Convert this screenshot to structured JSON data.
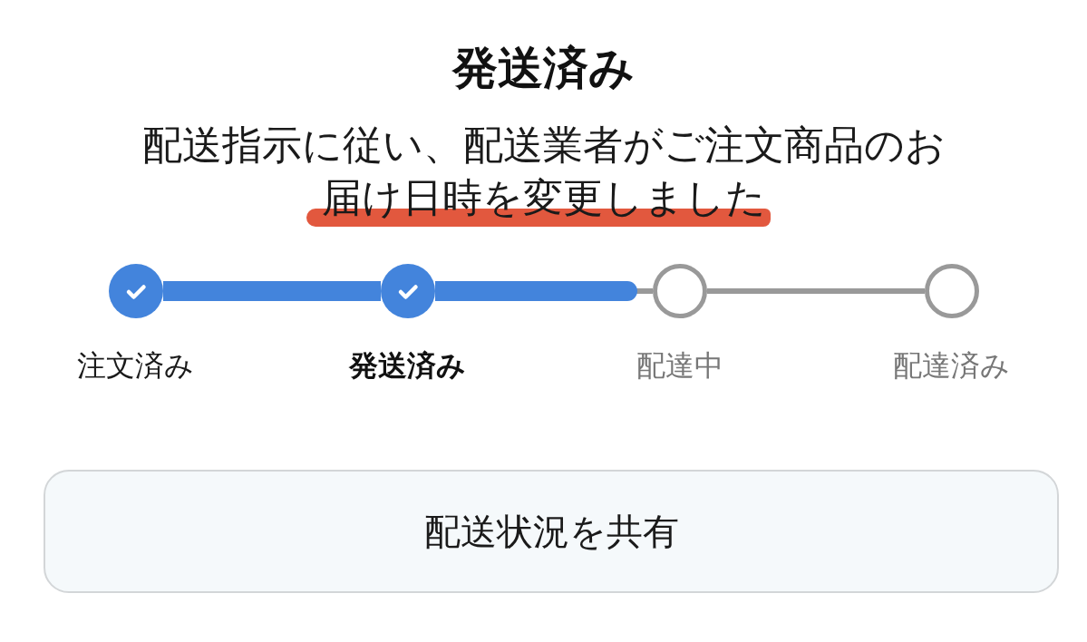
{
  "title": "発送済み",
  "message": {
    "lines": [
      {
        "text": "配送指示に従い、配送業者がご注文商品のお",
        "highlighted": false
      },
      {
        "text": "届け日時を変更しました",
        "highlighted": true
      }
    ]
  },
  "steps": [
    {
      "label": "注文済み",
      "done": true,
      "current": false
    },
    {
      "label": "発送済み",
      "done": true,
      "current": true
    },
    {
      "label": "配達中",
      "done": false,
      "current": false
    },
    {
      "label": "配達済み",
      "done": false,
      "current": false
    }
  ],
  "connectors": [
    {
      "kind": "done"
    },
    {
      "kind": "partial",
      "level": 0.93
    },
    {
      "kind": "pending"
    }
  ],
  "share_button": {
    "label": "配送状況を共有"
  }
}
